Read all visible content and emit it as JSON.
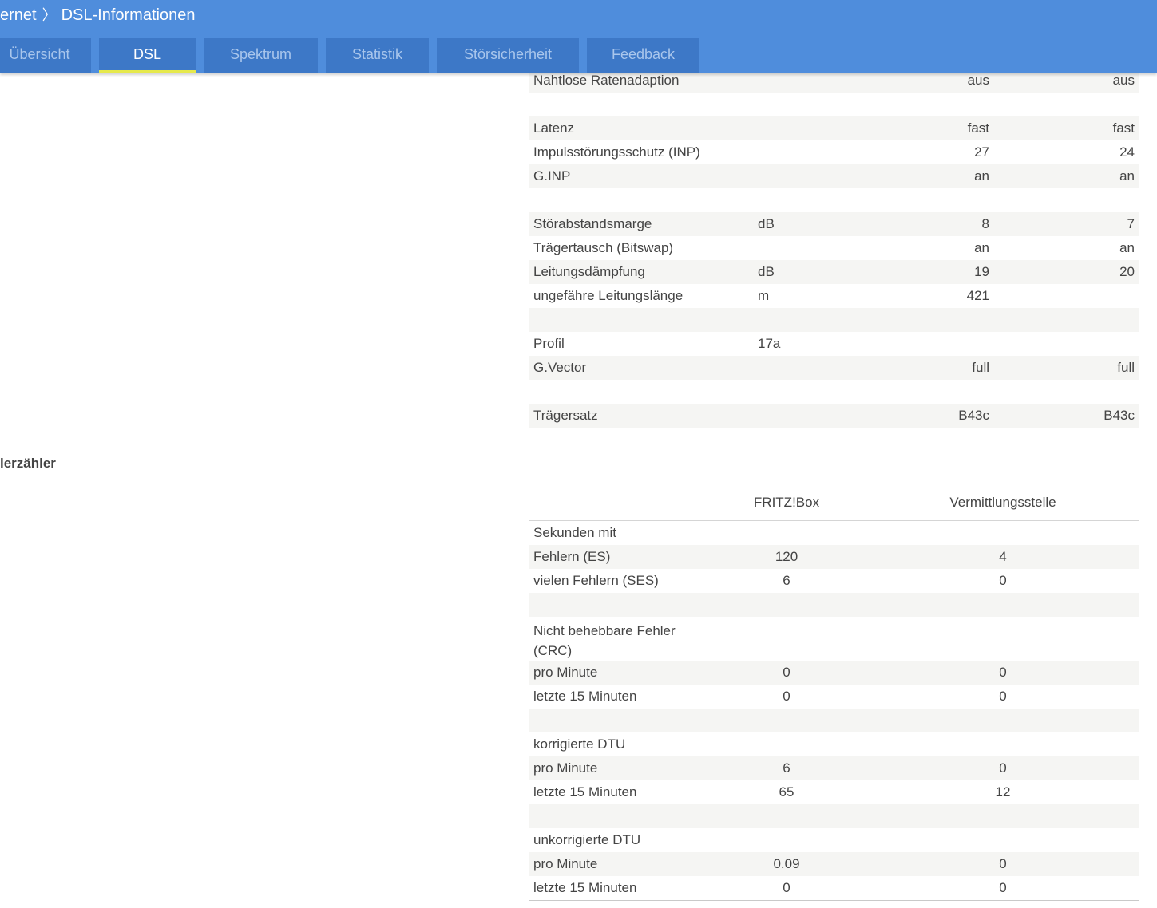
{
  "header": {
    "breadcrumb_parent": "ernet",
    "breadcrumb_sep": "〉",
    "breadcrumb_current": "DSL-Informationen"
  },
  "tabs": [
    {
      "label": "Übersicht",
      "active": false
    },
    {
      "label": "DSL",
      "active": true
    },
    {
      "label": "Spektrum",
      "active": false
    },
    {
      "label": "Statistik",
      "active": false
    },
    {
      "label": "Störsicherheit",
      "active": false
    },
    {
      "label": "Feedback",
      "active": false
    }
  ],
  "line_table": {
    "rows": [
      {
        "label": "Nahtlose Ratenadaption",
        "unit": "",
        "v1": "aus",
        "v2": "aus"
      },
      {
        "label": "",
        "unit": "",
        "v1": "",
        "v2": ""
      },
      {
        "label": "Latenz",
        "unit": "",
        "v1": "fast",
        "v2": "fast"
      },
      {
        "label": "Impulsstörungsschutz (INP)",
        "unit": "",
        "v1": "27",
        "v2": "24"
      },
      {
        "label": "G.INP",
        "unit": "",
        "v1": "an",
        "v2": "an"
      },
      {
        "label": "",
        "unit": "",
        "v1": "",
        "v2": ""
      },
      {
        "label": "Störabstandsmarge",
        "unit": "dB",
        "v1": "8",
        "v2": "7"
      },
      {
        "label": "Trägertausch (Bitswap)",
        "unit": "",
        "v1": "an",
        "v2": "an"
      },
      {
        "label": "Leitungsdämpfung",
        "unit": "dB",
        "v1": "19",
        "v2": "20"
      },
      {
        "label": "ungefähre Leitungslänge",
        "unit": "m",
        "v1": "421",
        "v2": ""
      },
      {
        "label": "",
        "unit": "",
        "v1": "",
        "v2": ""
      },
      {
        "label": "Profil",
        "unit": "17a",
        "v1": "",
        "v2": ""
      },
      {
        "label": "G.Vector",
        "unit": "",
        "v1": "full",
        "v2": "full"
      },
      {
        "label": "",
        "unit": "",
        "v1": "",
        "v2": ""
      },
      {
        "label": "Trägersatz",
        "unit": "",
        "v1": "B43c",
        "v2": "B43c"
      }
    ]
  },
  "errors_section": {
    "title": "lerzähler",
    "col_fritzbox": "FRITZ!Box",
    "col_exchange": "Vermittlungsstelle",
    "rows": [
      {
        "label": "Sekunden mit",
        "v1": "",
        "v2": ""
      },
      {
        "label": "Fehlern (ES)",
        "v1": "120",
        "v2": "4"
      },
      {
        "label": "vielen Fehlern (SES)",
        "v1": "6",
        "v2": "0"
      },
      {
        "label": "",
        "v1": "",
        "v2": ""
      },
      {
        "label": "Nicht behebbare Fehler (CRC)",
        "v1": "",
        "v2": ""
      },
      {
        "label": "pro Minute",
        "v1": "0",
        "v2": "0"
      },
      {
        "label": "letzte 15 Minuten",
        "v1": "0",
        "v2": "0"
      },
      {
        "label": "",
        "v1": "",
        "v2": ""
      },
      {
        "label": "korrigierte DTU",
        "v1": "",
        "v2": ""
      },
      {
        "label": "pro Minute",
        "v1": "6",
        "v2": "0"
      },
      {
        "label": "letzte 15 Minuten",
        "v1": "65",
        "v2": "12"
      },
      {
        "label": "",
        "v1": "",
        "v2": ""
      },
      {
        "label": "unkorrigierte DTU",
        "v1": "",
        "v2": ""
      },
      {
        "label": "pro Minute",
        "v1": "0.09",
        "v2": "0"
      },
      {
        "label": "letzte 15 Minuten",
        "v1": "0",
        "v2": "0"
      }
    ]
  }
}
